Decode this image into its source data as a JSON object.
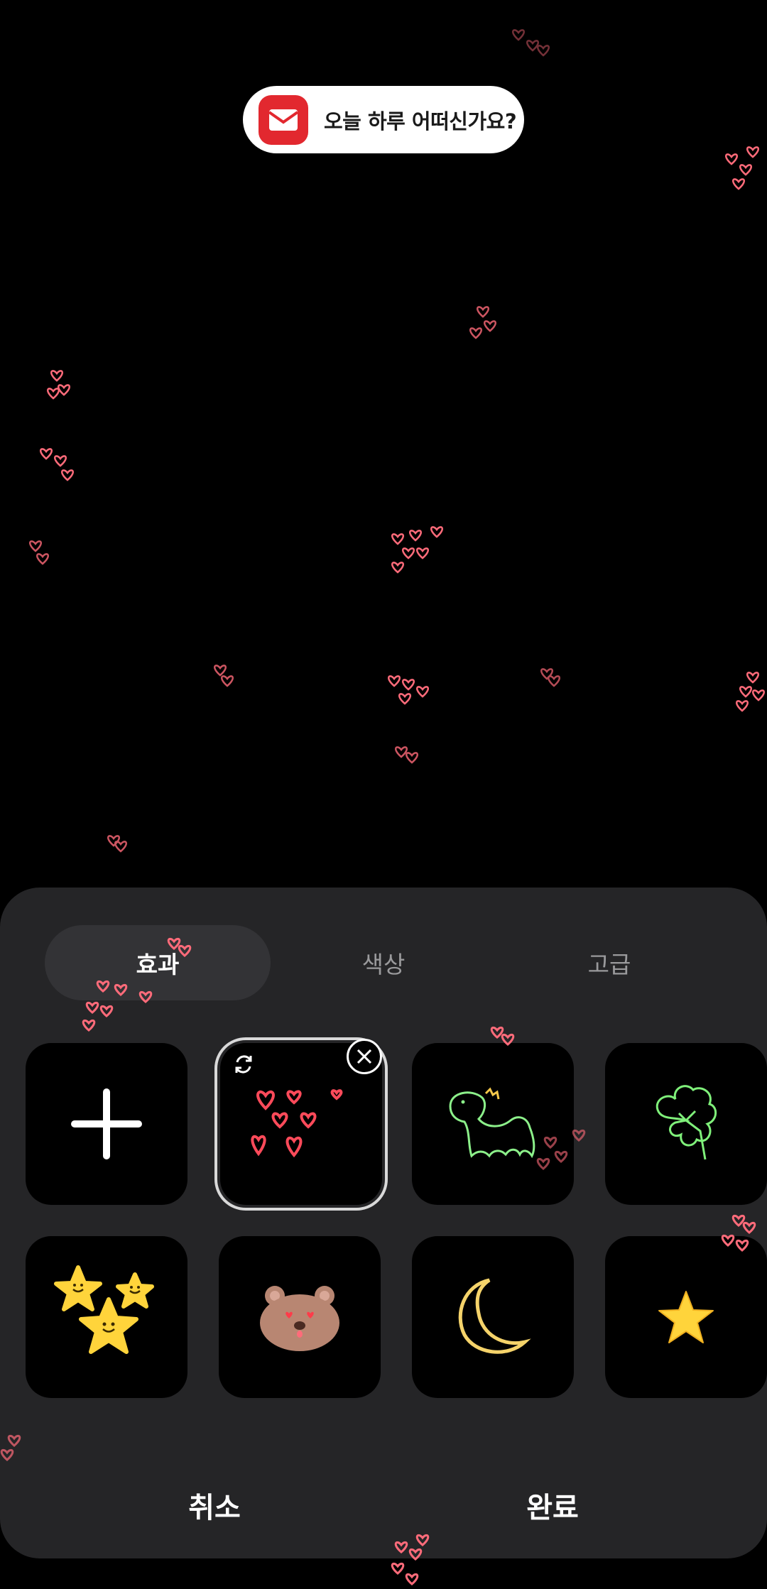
{
  "toast": {
    "text": "오늘 하루 어떠신가요?",
    "icon": "email-icon"
  },
  "tabs": [
    {
      "label": "효과",
      "active": true
    },
    {
      "label": "색상",
      "active": false
    },
    {
      "label": "고급",
      "active": false
    }
  ],
  "effects": [
    {
      "name": "add",
      "icon": "plus-icon"
    },
    {
      "name": "hearts",
      "icon": "hearts-icon",
      "selected": true
    },
    {
      "name": "dinosaur",
      "icon": "dinosaur-icon"
    },
    {
      "name": "clover",
      "icon": "clover-icon"
    },
    {
      "name": "stars",
      "icon": "smiling-stars-icon"
    },
    {
      "name": "bear",
      "icon": "bear-icon"
    },
    {
      "name": "moon",
      "icon": "moon-icon"
    },
    {
      "name": "star",
      "icon": "star-icon"
    }
  ],
  "footer": {
    "cancel_label": "취소",
    "done_label": "완료"
  },
  "colors": {
    "sheet": "#252527",
    "accent_red": "#e2282f",
    "heart_stroke": "#ff4a5a"
  }
}
